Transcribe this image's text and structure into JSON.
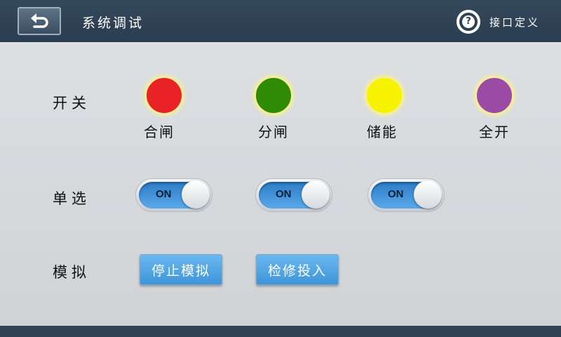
{
  "header": {
    "title": "系统调试",
    "help_label": "接口定义",
    "back_icon": "undo-arrow-icon",
    "help_icon": "question-circle-icon",
    "help_glyph": "?"
  },
  "switch_row": {
    "label": "开关",
    "lamps": [
      {
        "label": "合闸",
        "color": "#e92226"
      },
      {
        "label": "分闸",
        "color": "#2f8a06"
      },
      {
        "label": "储能",
        "color": "#f7f200"
      },
      {
        "label": "全开",
        "color": "#9b4ba6"
      }
    ]
  },
  "radio_row": {
    "label": "单选",
    "toggles": [
      {
        "state": "ON"
      },
      {
        "state": "ON"
      },
      {
        "state": "ON"
      }
    ]
  },
  "sim_row": {
    "label": "模拟",
    "buttons": [
      {
        "label": "停止模拟"
      },
      {
        "label": "检修投入"
      }
    ]
  },
  "colors": {
    "header_bg": "#2b3d50",
    "button_blue": "#3f95d9",
    "toggle_blue": "#2c7cc8"
  }
}
